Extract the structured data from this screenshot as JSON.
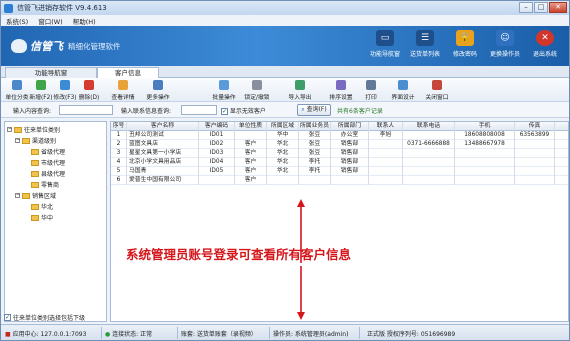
{
  "window": {
    "title": "信管飞进销存软件 V9.4.613"
  },
  "menu": [
    "系统(S)",
    "窗口(W)",
    "帮助(H)"
  ],
  "banner": {
    "brand": "信管飞",
    "subtitle": "精细化管理软件",
    "buttons": [
      "功能导航窗",
      "送货单列表",
      "修改密码",
      "更换操作员",
      "退出系统"
    ]
  },
  "tabs": [
    "功能导航窗",
    "客户信息"
  ],
  "toolbar": [
    "单位分类",
    "新增(F2)",
    "修改(F3)",
    "删除(D)",
    "查看详情",
    "更多操作",
    "批量操作",
    "锁定/撤锁",
    "导入导出",
    "排序设置",
    "打印",
    "界面设计",
    "关闭窗口"
  ],
  "filter": {
    "search_label": "输入内容查询:",
    "contact_label": "输入联系信息查询:",
    "show_invalid": "显示无效客户",
    "query_button": "查询(F)",
    "summary": "共有6条客户记录"
  },
  "tree": {
    "root": "往来单位类别",
    "nodes": [
      "渠道级别",
      "省级代理",
      "市级代理",
      "县级代理",
      "零售商",
      "销售区域",
      "华北",
      "华中"
    ],
    "footer": "往来单位类别选择包括下级"
  },
  "grid": {
    "columns": [
      "序号",
      "客户名称",
      "客户编码",
      "单位性质",
      "所属区域",
      "所属业务员",
      "所属部门",
      "联系人",
      "联系电话",
      "手机",
      "传真"
    ],
    "rows": [
      [
        "1",
        "丑邦公司测试",
        "ID01",
        "",
        "华中",
        "张豆",
        "办公室",
        "李旭",
        "",
        "18608808008",
        "63563899"
      ],
      [
        "2",
        "蓝图文具店",
        "ID02",
        "客户",
        "华北",
        "张豆",
        "销售部",
        "",
        "0371-6666888",
        "13488667978",
        ""
      ],
      [
        "3",
        "星星文具第一小学店",
        "ID03",
        "客户",
        "华北",
        "张豆",
        "销售部",
        "",
        "",
        "",
        ""
      ],
      [
        "4",
        "北京小学文具用品店",
        "ID04",
        "客户",
        "华北",
        "李托",
        "销售部",
        "",
        "",
        "",
        ""
      ],
      [
        "5",
        "马国青",
        "ID05",
        "客户",
        "华北",
        "李托",
        "销售部",
        "",
        "",
        "",
        ""
      ],
      [
        "6",
        "爱普生中国有限公司",
        "",
        "客户",
        "",
        "",
        "",
        "",
        "",
        "",
        ""
      ]
    ]
  },
  "annotation": "系统管理员账号登录可查看所有客户信息",
  "status": {
    "center": "应用中心: 127.0.0.1:7093",
    "connection": "连接状态: 正常",
    "account": "账套: 送货单账套（录视频）",
    "operator": "操作员: 系统管理员(admin)",
    "license": "正式版  授权序列号: 051696989"
  }
}
